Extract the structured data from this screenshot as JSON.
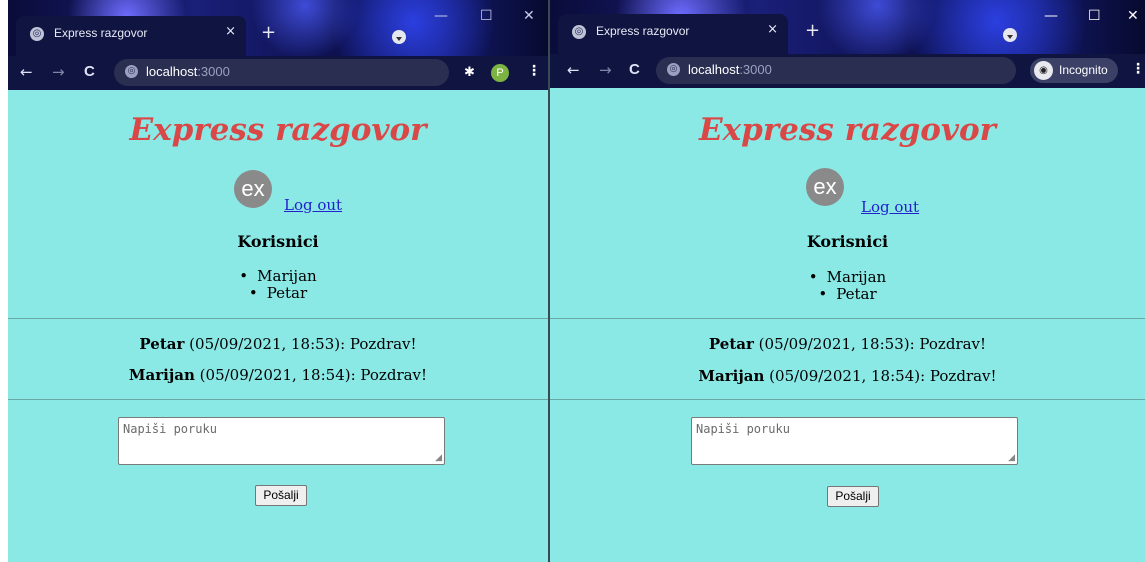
{
  "browser": {
    "tab_title": "Express razgovor",
    "tab_close": "×",
    "new_tab": "+",
    "url_host": "localhost",
    "url_port": ":3000",
    "back": "←",
    "forward": "→",
    "reload": "C",
    "menu": "⋮",
    "extensions_icon": "puzzle-icon",
    "profile_initial": "P",
    "incognito_label": "Incognito",
    "window_controls": {
      "minimize": "—",
      "maximize": "☐",
      "close": "✕"
    }
  },
  "page": {
    "title": "Express razgovor",
    "logo_text": "ex",
    "logout_label": "Log out",
    "users_heading": "Korisnici",
    "users": [
      "Marijan",
      "Petar"
    ],
    "messages": [
      {
        "author": "Petar",
        "meta": " (05/09/2021, 18:53): Pozdrav!"
      },
      {
        "author": "Marijan",
        "meta": " (05/09/2021, 18:54): Pozdrav!"
      }
    ],
    "message_placeholder": "Napiši poruku",
    "send_label": "Pošalji"
  },
  "colors": {
    "page_background": "#8ae8e5",
    "title_color": "#d94747",
    "link_color": "#2222cc",
    "logo_background": "#8a8a8a",
    "browser_toolbar": "#0f1440"
  }
}
